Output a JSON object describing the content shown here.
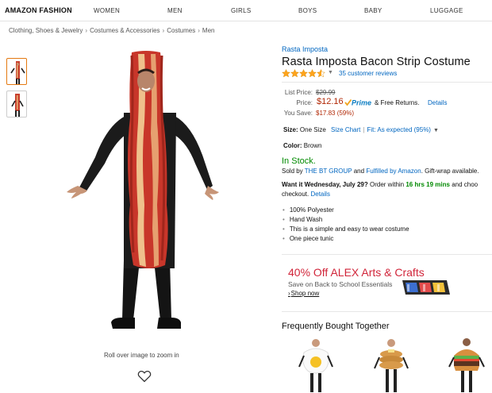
{
  "topnav": {
    "brand": "AMAZON FASHION",
    "items": [
      "WOMEN",
      "MEN",
      "GIRLS",
      "BOYS",
      "BABY",
      "LUGGAGE"
    ]
  },
  "breadcrumb": [
    "Clothing, Shoes & Jewelry",
    "Costumes & Accessories",
    "Costumes",
    "Men"
  ],
  "breadcrumb_sep": "›",
  "gallery": {
    "zoom_hint": "Roll over image to zoom in",
    "heart_icon": "heart-outline-icon"
  },
  "product": {
    "brand": "Rasta Imposta",
    "title": "Rasta Imposta Bacon Strip Costume",
    "rating_stars": 4.5,
    "reviews": "35 customer reviews",
    "list_price_label": "List Price:",
    "list_price": "$29.99",
    "price_label": "Price:",
    "price": "$12.16",
    "prime_label": "Prime",
    "free_returns": "& Free Returns.",
    "details": "Details",
    "you_save_label": "You Save:",
    "you_save": "$17.83 (59%)",
    "size_label": "Size:",
    "size_value": "One Size",
    "size_chart": "Size Chart",
    "fit_label": "Fit: As expected (95%)",
    "color_label": "Color:",
    "color_value": "Brown",
    "stock": "In Stock.",
    "sold_by_prefix": "Sold by",
    "seller": "THE BT GROUP",
    "sold_by_mid": "and",
    "fulfilled": "Fulfilled by Amazon",
    "sold_by_suffix": ". Gift-wrap available.",
    "delivery_want": "Want it Wednesday, July 29?",
    "delivery_order": "Order within",
    "delivery_time": "16 hrs 19 mins",
    "delivery_and": "and choo",
    "delivery_checkout": "checkout.",
    "delivery_details": "Details",
    "bullets": [
      "100% Polyester",
      "Hand Wash",
      "This is a simple and easy to wear costume",
      "One piece tunic"
    ]
  },
  "ad": {
    "headline": "40% Off ALEX Arts & Crafts",
    "sub": "Save on Back to School Essentials",
    "shop_arrow": "›",
    "shop_now": "Shop now"
  },
  "fbt": {
    "title": "Frequently Bought Together"
  },
  "colors": {
    "link": "#0066c0",
    "price": "#b12704",
    "stock": "#008a00",
    "star": "#ffa41c",
    "ad_red": "#d1253a",
    "thumb_active": "#e47911"
  }
}
